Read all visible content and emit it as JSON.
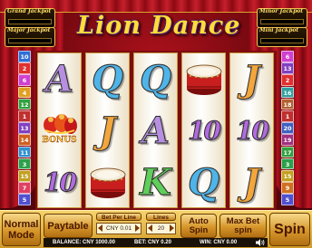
{
  "game": {
    "title": "Lion Dance"
  },
  "jackpots": {
    "grand": "Grand Jackpot",
    "major": "Major Jackpot",
    "minor": "Minor Jackpot",
    "mini": "Mini Jackpot"
  },
  "paylines": {
    "left": [
      {
        "num": "10",
        "color": "#2f6fd6"
      },
      {
        "num": "2",
        "color": "#e03030"
      },
      {
        "num": "6",
        "color": "#d040d0"
      },
      {
        "num": "4",
        "color": "#e0a020"
      },
      {
        "num": "12",
        "color": "#30a040"
      },
      {
        "num": "1",
        "color": "#c03030"
      },
      {
        "num": "13",
        "color": "#8040c0"
      },
      {
        "num": "14",
        "color": "#d06020"
      },
      {
        "num": "11",
        "color": "#3090d0"
      },
      {
        "num": "3",
        "color": "#2ba04a"
      },
      {
        "num": "15",
        "color": "#c0a020"
      },
      {
        "num": "7",
        "color": "#e04060"
      },
      {
        "num": "5",
        "color": "#5050d0"
      }
    ],
    "right": [
      {
        "num": "6",
        "color": "#d040d0"
      },
      {
        "num": "13",
        "color": "#8040c0"
      },
      {
        "num": "2",
        "color": "#e03030"
      },
      {
        "num": "16",
        "color": "#30a0a0"
      },
      {
        "num": "18",
        "color": "#b06030"
      },
      {
        "num": "1",
        "color": "#c03030"
      },
      {
        "num": "20",
        "color": "#4060c0"
      },
      {
        "num": "19",
        "color": "#a03080"
      },
      {
        "num": "17",
        "color": "#30a040"
      },
      {
        "num": "3",
        "color": "#2ba04a"
      },
      {
        "num": "15",
        "color": "#c0a020"
      },
      {
        "num": "9",
        "color": "#d07020"
      },
      {
        "num": "5",
        "color": "#5050d0"
      }
    ]
  },
  "reels": [
    [
      "A",
      "BONUS",
      "10"
    ],
    [
      "Q",
      "J",
      "DRUM"
    ],
    [
      "Q",
      "A",
      "K"
    ],
    [
      "DRUM",
      "10",
      "Q"
    ],
    [
      "J",
      "10",
      "J"
    ]
  ],
  "symbols": {
    "bonus_label": "BONUS"
  },
  "controls": {
    "normal_mode": "Normal Mode",
    "paytable": "Paytable",
    "bet_per_line_label": "Bet Per Line",
    "bet_per_line_value": "CNY 0.01",
    "lines_label": "Lines",
    "lines_value": "20",
    "auto_spin": "Auto Spin",
    "max_bet_spin": "Max Bet spin",
    "spin": "Spin"
  },
  "status": {
    "balance": "BALANCE: CNY 1000.00",
    "bet": "BET: CNY 0.20",
    "win": "WIN: CNY 0.00"
  },
  "colors": {
    "curtain": "#b0121c",
    "panel": "#e3b440",
    "accent": "#ffdc3a"
  }
}
